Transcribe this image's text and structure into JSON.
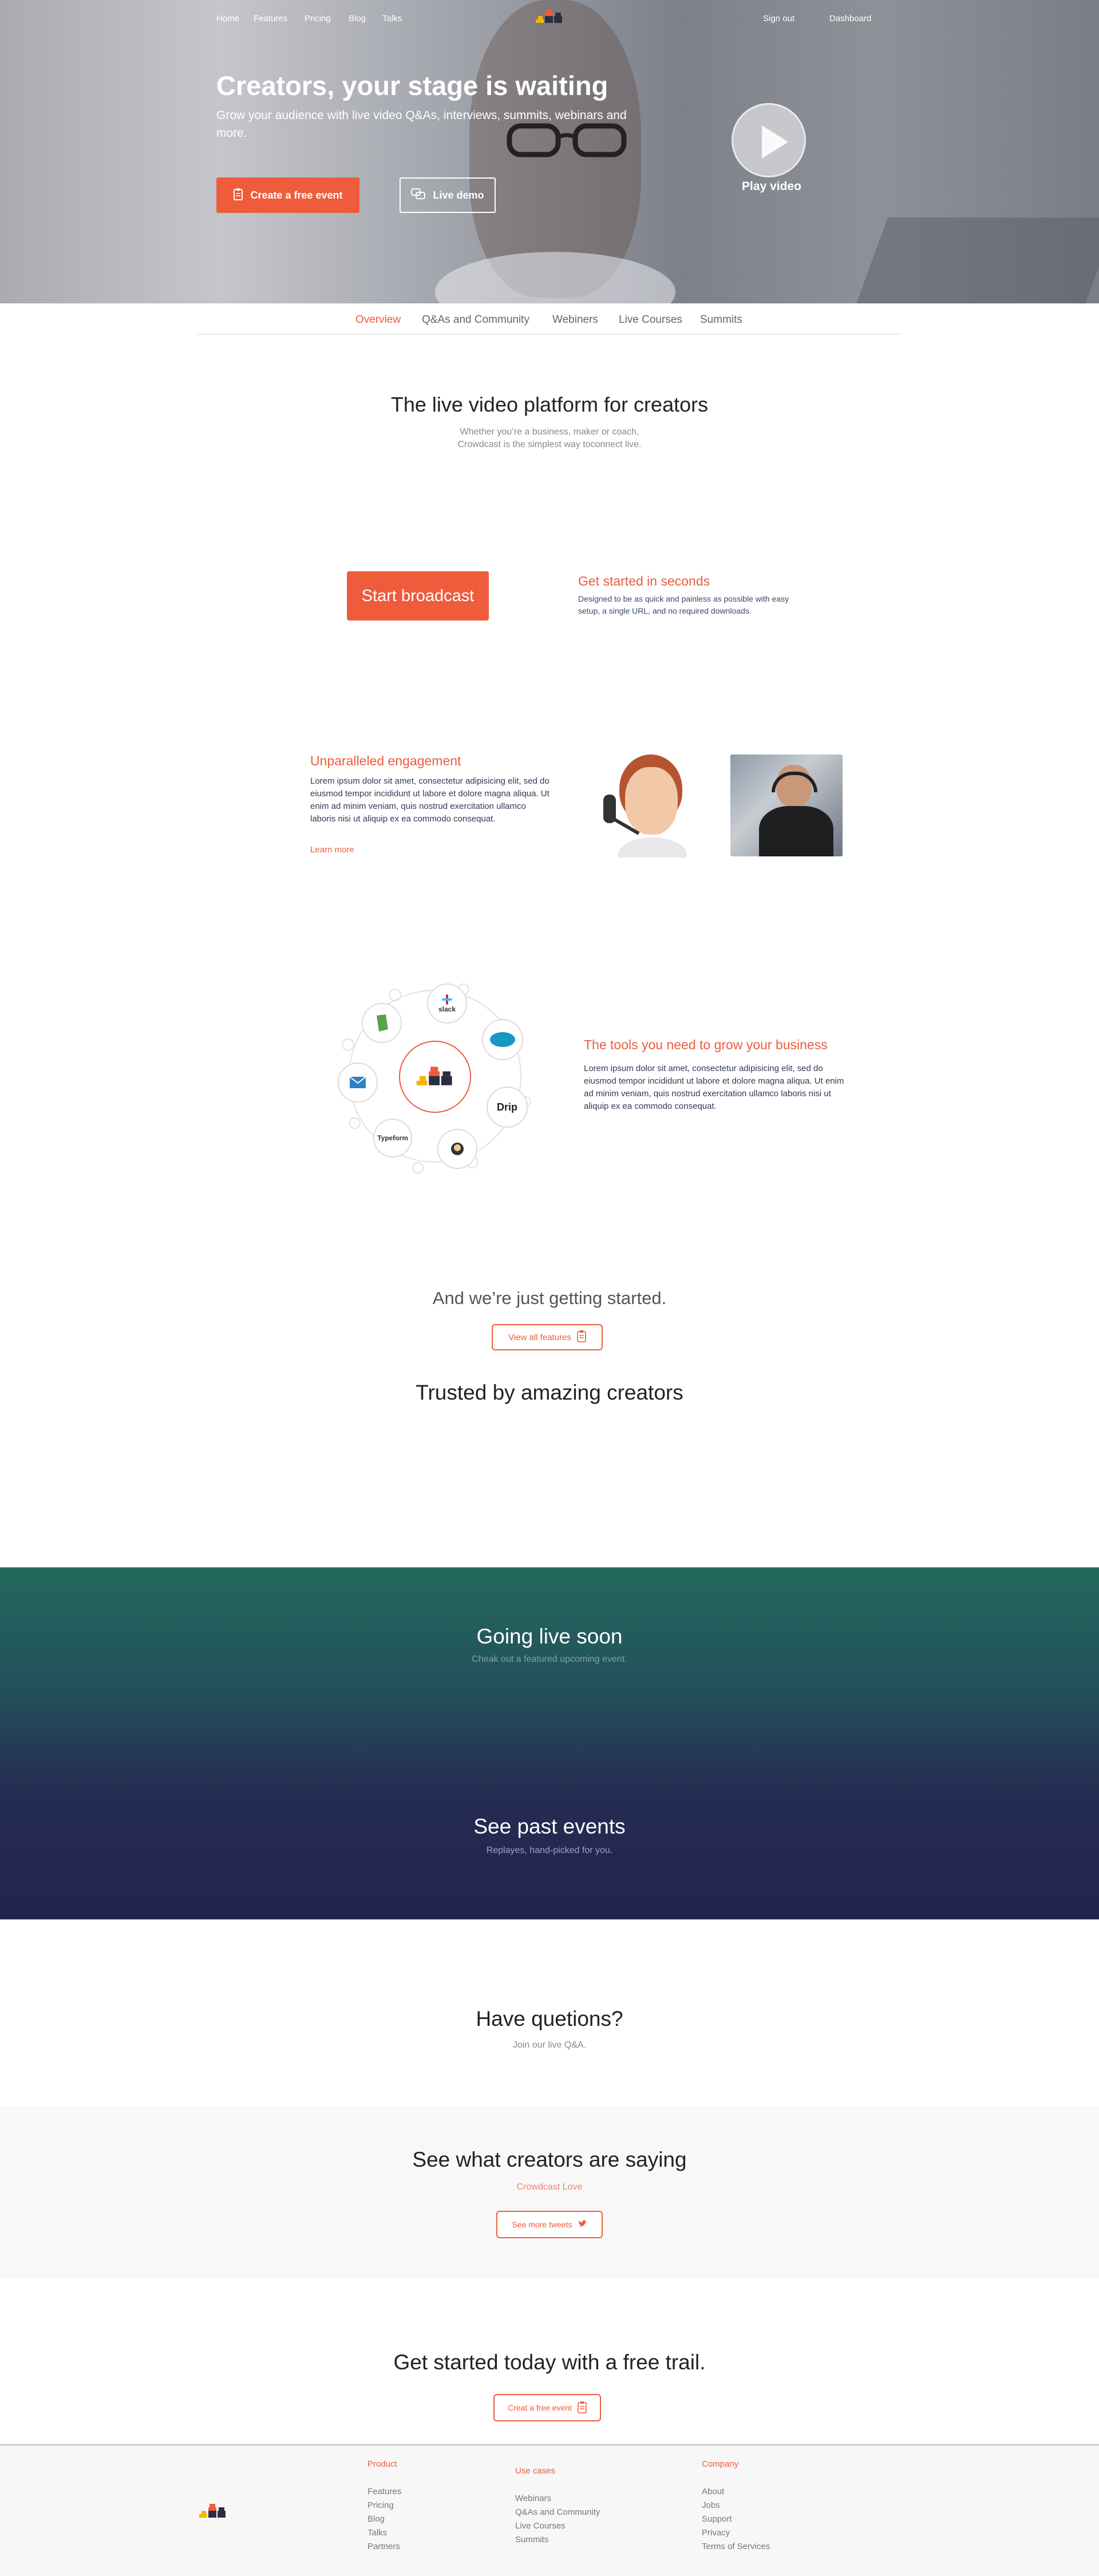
{
  "nav": {
    "links": [
      "Home",
      "Features",
      "Pricing",
      "Blog",
      "Talks"
    ],
    "sign_out": "Sign out",
    "dashboard": "Dashboard"
  },
  "hero": {
    "title": "Creators, your stage is waiting",
    "subtitle": "Grow your audience with live video Q&As, interviews, summits, webinars and more.",
    "cta_free": "Create a free event",
    "cta_demo": "Live demo",
    "play_label": "Play video"
  },
  "subnav": {
    "items": [
      "Overview",
      "Q&As and Community",
      "Webiners",
      "Live Courses",
      "Summits"
    ]
  },
  "intro": {
    "title": "The live video platform for creators",
    "text_line1": "Whether you’re a business, maker or coach,",
    "text_line2": "Crowdcast is the simplest way toconnect live."
  },
  "broadcast": {
    "button": "Start broadcast",
    "title": "Get started in seconds",
    "text_line1": "Designed to be as quick and painless as possible with easy",
    "text_line2": "setup, a single URL, and no required downloads."
  },
  "engagement": {
    "title": "Unparalleled engagement",
    "text": "Lorem ipsum dolor sit amet, consectetur adipisicing elit, sed do eiusmod tempor incididunt ut labore et dolore magna aliqua. Ut enim ad minim veniam, quis nostrud exercitation ullamco laboris nisi ut aliquip ex ea commodo consequat.",
    "link": "Learn more"
  },
  "tools": {
    "title": "The tools you need to grow your business",
    "text": "Lorem ipsum dolor sit amet, consectetur adipisicing elit, sed do eiusmod tempor incididunt ut labore et dolore magna aliqua. Ut enim ad minim veniam, quis nostrud exercitation ullamco laboris nisi ut aliquip ex ea commodo consequat.",
    "integrations": [
      "slack",
      "Drip",
      "Typeform"
    ]
  },
  "features": {
    "title": "And we’re just getting started.",
    "button": "View all features"
  },
  "trusted": {
    "title": "Trusted by amazing creators"
  },
  "live_soon": {
    "title": "Going live soon",
    "subtitle": "Cheak  out a featured upcoming event."
  },
  "past": {
    "title": "See past events",
    "subtitle": "Replayes, hand-picked for you."
  },
  "questions": {
    "title": "Have quetions?",
    "subtitle": "Join our live Q&A."
  },
  "saying": {
    "title": "See what creators are saying",
    "subtitle": "Crowdcast Love",
    "button": "See more tweets"
  },
  "getstarted": {
    "title": "Get started today with a free trail.",
    "button": "Creat a free event"
  },
  "footer": {
    "product": {
      "heading": "Product",
      "links": [
        "Features",
        "Pricing",
        "Blog",
        "Talks",
        "Partners"
      ]
    },
    "usecases": {
      "heading": "Use cases",
      "links": [
        "Webinars",
        "Q&As and Community",
        "Live Courses",
        "Summits"
      ]
    },
    "company": {
      "heading": "Company",
      "links": [
        "About",
        "Jobs",
        "Support",
        "Privacy",
        "Terms of Services"
      ]
    }
  },
  "colors": {
    "accent": "#ee5c3c",
    "band_top": "#226a5c",
    "band_bottom": "#23244e"
  }
}
